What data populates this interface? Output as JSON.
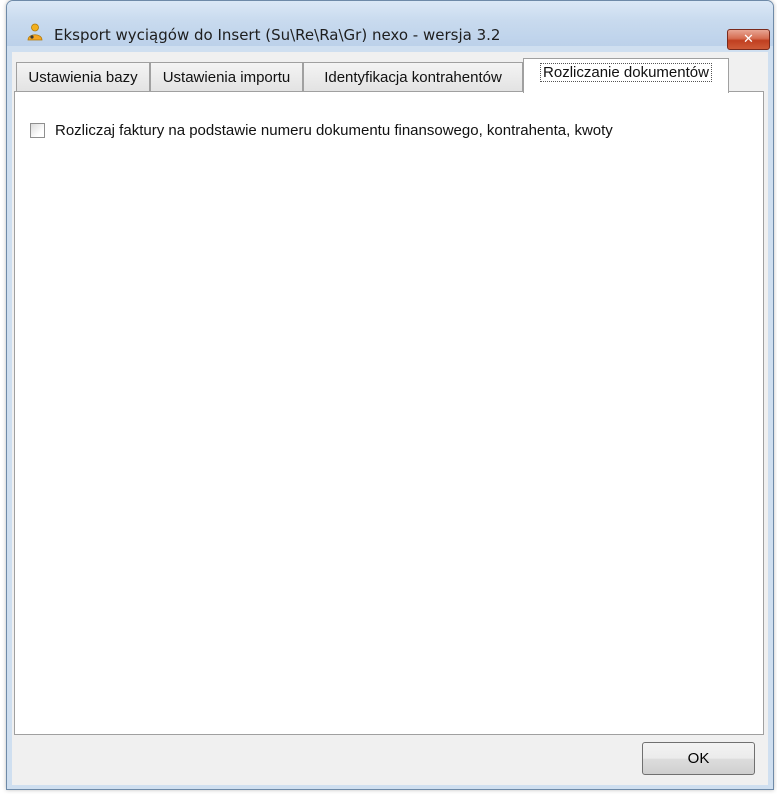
{
  "window": {
    "title": "Eksport wyciągów do Insert (Su\\Re\\Ra\\Gr) nexo - wersja 3.2",
    "app_icon": "person-icon",
    "close_glyph": "✕",
    "accent_color": "#c03f20"
  },
  "tabs": [
    {
      "label": "Ustawienia bazy",
      "active": false
    },
    {
      "label": "Ustawienia importu",
      "active": false
    },
    {
      "label": "Identyfikacja kontrahentów",
      "active": false
    },
    {
      "label": "Rozliczanie dokumentów",
      "active": true
    }
  ],
  "settlement": {
    "checkbox_label": "Rozliczaj faktury na podstawie numeru dokumentu finansowego, kontrahenta, kwoty",
    "checked": false
  },
  "footer": {
    "ok_label": "OK"
  }
}
